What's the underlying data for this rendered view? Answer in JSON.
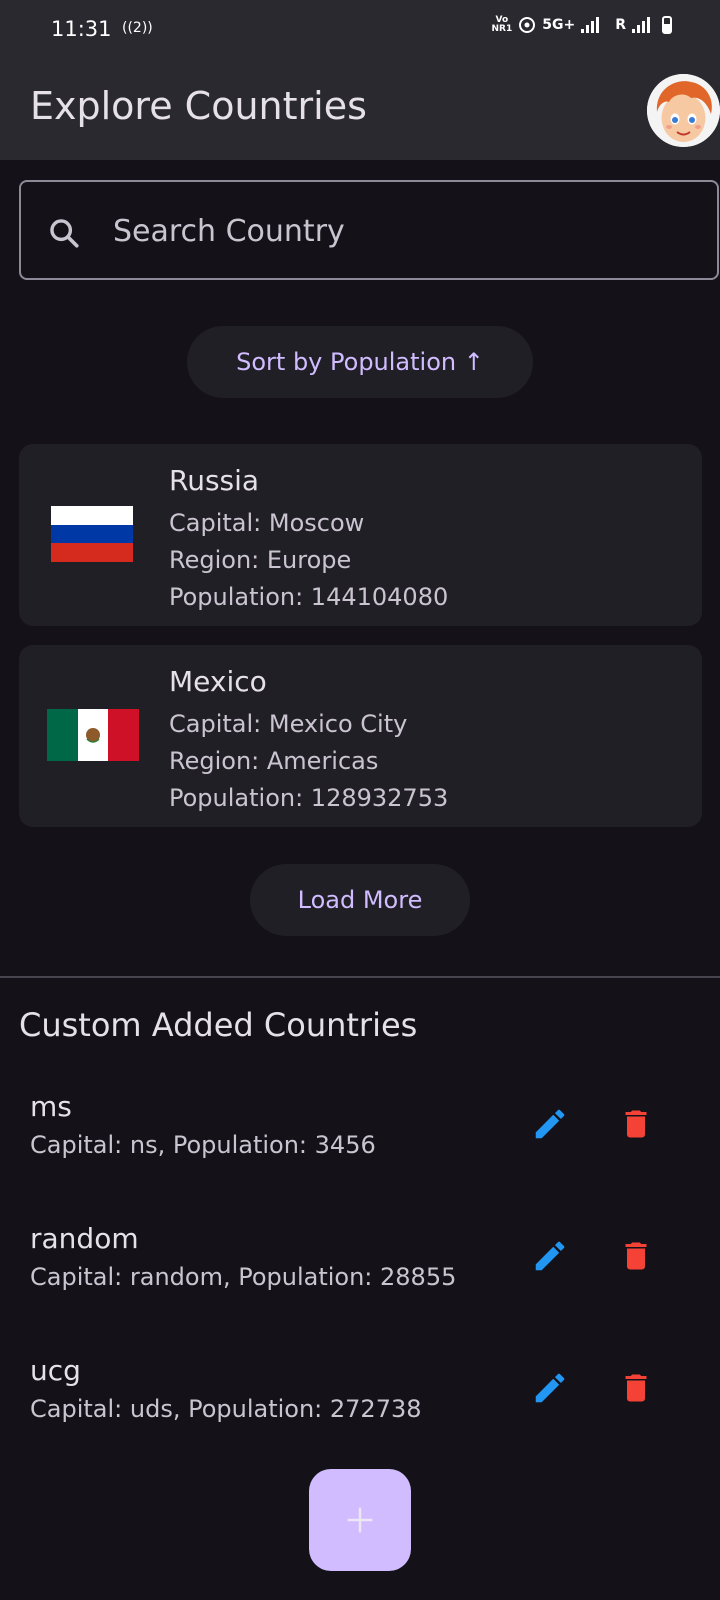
{
  "status_bar": {
    "time": "11:31",
    "hotspot_glyph": "((2))",
    "volte_top": "Vo",
    "volte_bottom": "NR1",
    "network": "5G+",
    "roaming": "R"
  },
  "header": {
    "title": "Explore Countries"
  },
  "search": {
    "placeholder": "Search Country",
    "value": ""
  },
  "sort_button": {
    "label": "Sort by Population ↑"
  },
  "countries": [
    {
      "name": "Russia",
      "capital": "Capital: Moscow",
      "region": "Region: Europe",
      "population": "Population: 144104080",
      "flag": "russia-flag"
    },
    {
      "name": "Mexico",
      "capital": "Capital: Mexico City",
      "region": "Region: Americas",
      "population": "Population: 128932753",
      "flag": "mexico-flag"
    }
  ],
  "load_more": {
    "label": "Load More"
  },
  "custom_section": {
    "title": "Custom Added Countries",
    "items": [
      {
        "name": "ms",
        "detail": "Capital: ns, Population: 3456"
      },
      {
        "name": "random",
        "detail": "Capital: random, Population: 28855"
      },
      {
        "name": "ucg",
        "detail": "Capital: uds, Population: 272738"
      }
    ]
  },
  "fab": {
    "icon": "plus-icon"
  },
  "colors": {
    "background": "#141218",
    "surface": "#211f26",
    "appbar": "#2b2930",
    "primary": "#d0bcff",
    "edit": "#2196f3",
    "delete": "#f44336"
  }
}
